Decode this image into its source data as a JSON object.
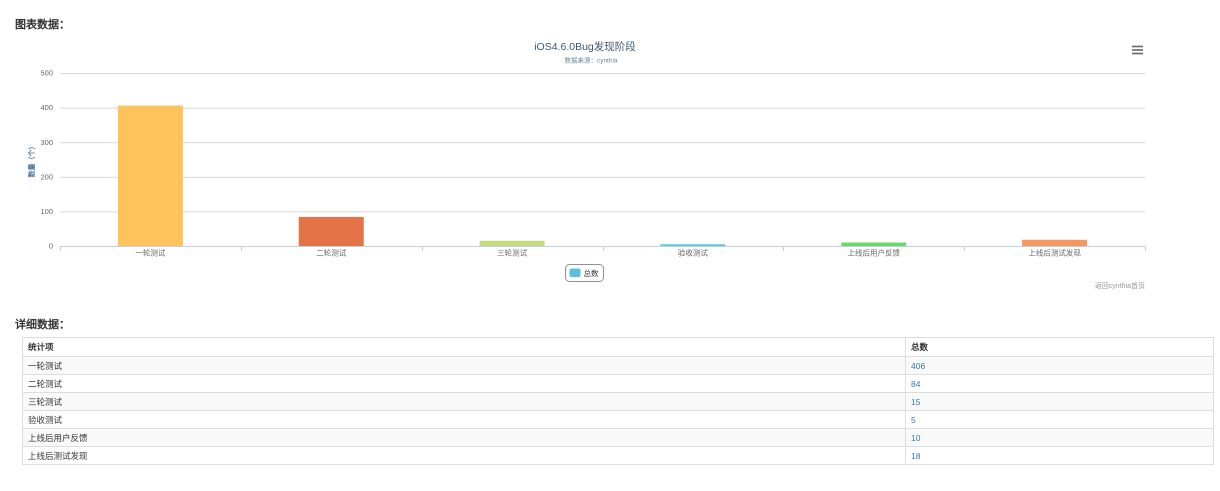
{
  "page": {
    "chart_heading": "图表数据：",
    "detail_heading": "详细数据："
  },
  "chart_data": {
    "type": "bar",
    "title": "iOS4.6.0Bug发现阶段",
    "subtitle": "数据来源：cynthia",
    "ylabel": "数量（个）",
    "ylim": [
      0,
      500
    ],
    "yticks": [
      0,
      100,
      200,
      300,
      400,
      500
    ],
    "categories": [
      "一轮测试",
      "二轮测试",
      "三轮测试",
      "验收测试",
      "上线后用户反馈",
      "上线后测试发现"
    ],
    "series": [
      {
        "name": "总数",
        "values": [
          406,
          84,
          15,
          5,
          10,
          18
        ],
        "colors": [
          "#fec35a",
          "#e57348",
          "#c7d87f",
          "#5bc8de",
          "#6cd86c",
          "#f59860"
        ],
        "legend_color": "#5bc0de"
      }
    ],
    "legend": "bottom-center",
    "grid": true
  },
  "chart_toolbar": {
    "menu_icon": "menu-icon"
  },
  "home_link": {
    "label": "返回cynthia首页"
  },
  "detail_table": {
    "headers": [
      "统计项",
      "总数"
    ],
    "rows": [
      {
        "item": "一轮测试",
        "total": 406
      },
      {
        "item": "二轮测试",
        "total": 84
      },
      {
        "item": "三轮测试",
        "total": 15
      },
      {
        "item": "验收测试",
        "total": 5
      },
      {
        "item": "上线后用户反馈",
        "total": 10
      },
      {
        "item": "上线后测试发现",
        "total": 18
      }
    ]
  },
  "theme": {
    "link_color": "#337ab7"
  }
}
